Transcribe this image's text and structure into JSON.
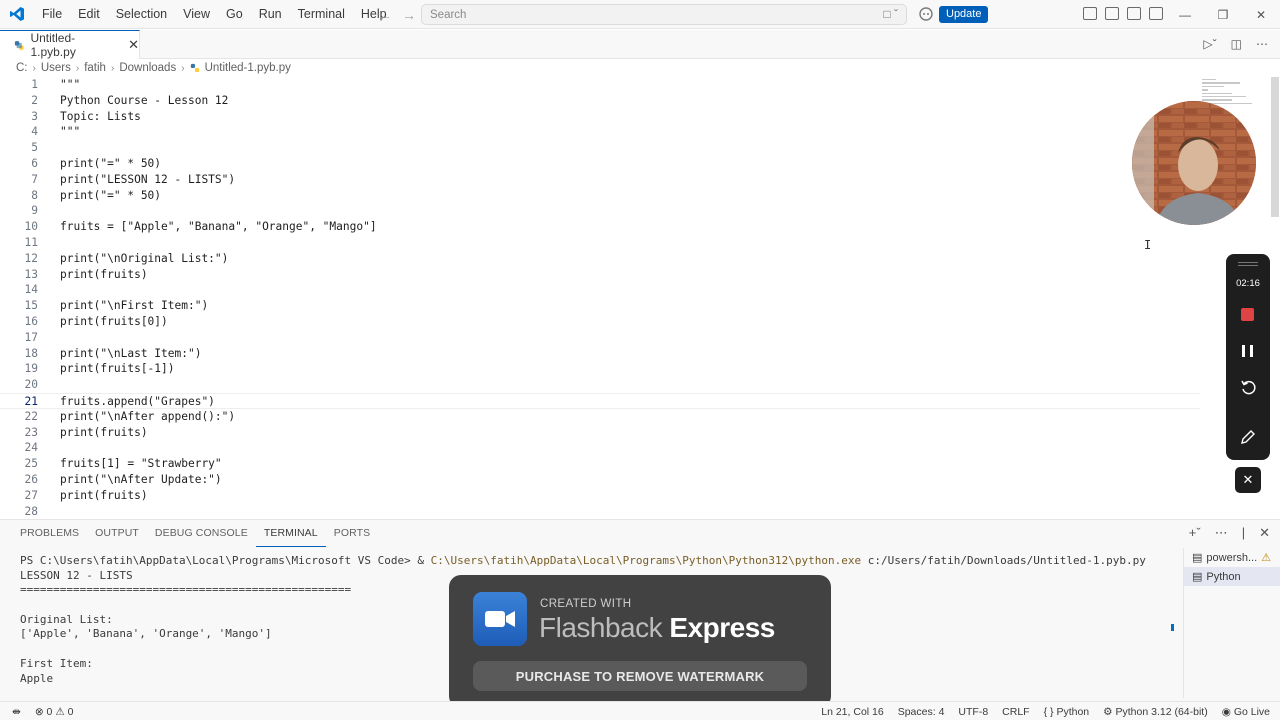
{
  "menu": [
    "File",
    "Edit",
    "Selection",
    "View",
    "Go",
    "Run",
    "Terminal",
    "Help"
  ],
  "search": {
    "placeholder": "Search"
  },
  "update_label": "Update",
  "tab": {
    "label": "Untitled-1.pyb.py"
  },
  "breadcrumb": [
    "C:",
    "Users",
    "fatih",
    "Downloads",
    "Untitled-1.pyb.py"
  ],
  "editor": {
    "active_line": 21,
    "lines": [
      {
        "n": "1",
        "code": "\"\"\""
      },
      {
        "n": "2",
        "code": "Python Course - Lesson 12"
      },
      {
        "n": "3",
        "code": "Topic: Lists"
      },
      {
        "n": "4",
        "code": "\"\"\""
      },
      {
        "n": "5",
        "code": ""
      },
      {
        "n": "6",
        "code": "print(\"=\" * 50)"
      },
      {
        "n": "7",
        "code": "print(\"LESSON 12 - LISTS\")"
      },
      {
        "n": "8",
        "code": "print(\"=\" * 50)"
      },
      {
        "n": "9",
        "code": ""
      },
      {
        "n": "10",
        "code": "fruits = [\"Apple\", \"Banana\", \"Orange\", \"Mango\"]"
      },
      {
        "n": "11",
        "code": ""
      },
      {
        "n": "12",
        "code": "print(\"\\nOriginal List:\")"
      },
      {
        "n": "13",
        "code": "print(fruits)"
      },
      {
        "n": "14",
        "code": ""
      },
      {
        "n": "15",
        "code": "print(\"\\nFirst Item:\")"
      },
      {
        "n": "16",
        "code": "print(fruits[0])"
      },
      {
        "n": "17",
        "code": ""
      },
      {
        "n": "18",
        "code": "print(\"\\nLast Item:\")"
      },
      {
        "n": "19",
        "code": "print(fruits[-1])"
      },
      {
        "n": "20",
        "code": ""
      },
      {
        "n": "21",
        "code": "fruits.append(\"Grapes\")"
      },
      {
        "n": "22",
        "code": "print(\"\\nAfter append():\")"
      },
      {
        "n": "23",
        "code": "print(fruits)"
      },
      {
        "n": "24",
        "code": ""
      },
      {
        "n": "25",
        "code": "fruits[1] = \"Strawberry\""
      },
      {
        "n": "26",
        "code": "print(\"\\nAfter Update:\")"
      },
      {
        "n": "27",
        "code": "print(fruits)"
      },
      {
        "n": "28",
        "code": ""
      }
    ]
  },
  "recorder": {
    "time": "02:16"
  },
  "panel": {
    "tabs": [
      "PROBLEMS",
      "OUTPUT",
      "DEBUG CONSOLE",
      "TERMINAL",
      "PORTS"
    ],
    "active_tab": "TERMINAL",
    "terminal": {
      "prompt": "PS C:\\Users\\fatih\\AppData\\Local\\Programs\\Microsoft VS Code> & ",
      "exe": "C:\\Users\\fatih\\AppData\\Local\\Programs\\Python\\Python312\\python.exe",
      "arg": " c:/Users/fatih/Downloads/Untitled-1.pyb.py",
      "output": [
        "LESSON 12 - LISTS",
        "==================================================",
        "",
        "Original List:",
        "['Apple', 'Banana', 'Orange', 'Mango']",
        "",
        "First Item:",
        "Apple"
      ]
    },
    "terminal_list": [
      "powersh...",
      "Python"
    ]
  },
  "watermark": {
    "created": "CREATED WITH",
    "brand_light": "Flashback",
    "brand_bold": "Express",
    "button": "PURCHASE TO REMOVE WATERMARK"
  },
  "status": {
    "errors": "0",
    "warnings": "0",
    "position": "Ln 21, Col 16",
    "spaces": "Spaces: 4",
    "encoding": "UTF-8",
    "eol": "CRLF",
    "language": "Python",
    "language_prefix": "{ }",
    "interpreter": "Python 3.12 (64-bit)",
    "golive": "Go Live"
  },
  "colors": {
    "accent": "#005fb8",
    "record": "#e04343"
  }
}
